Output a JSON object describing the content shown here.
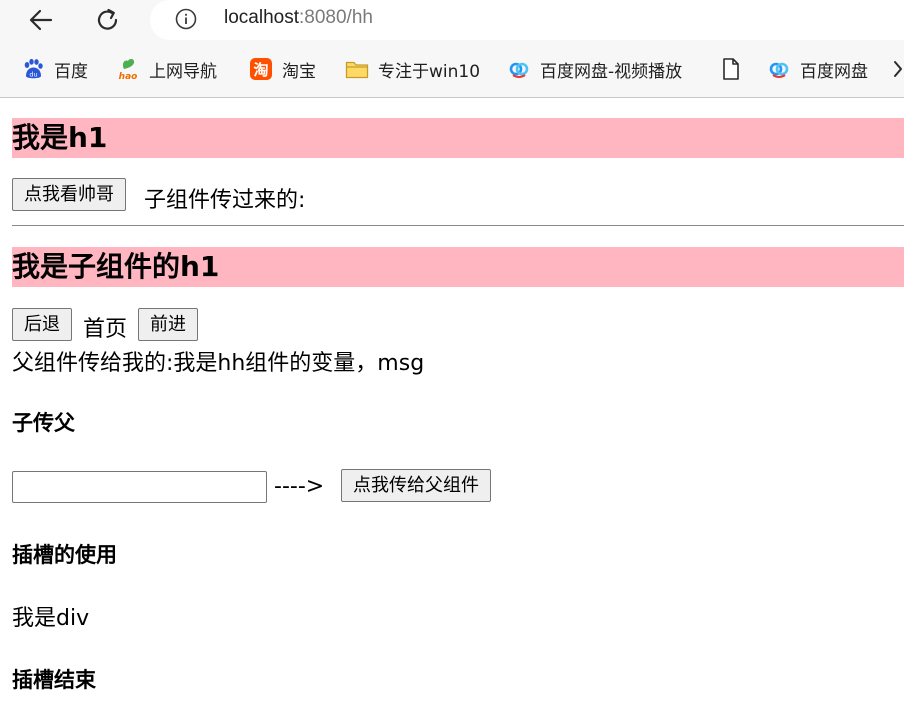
{
  "browser": {
    "url_host": "localhost",
    "url_rest": ":8080/hh",
    "bookmarks": [
      {
        "label": "百度",
        "icon": "baidu-paw-icon"
      },
      {
        "label": "上网导航",
        "icon": "hao-icon"
      },
      {
        "label": "淘宝",
        "icon": "taobao-icon"
      },
      {
        "label": "专注于win10",
        "icon": "folder-icon"
      },
      {
        "label": "百度网盘-视频播放",
        "icon": "baidu-netdisk-icon"
      },
      {
        "label": "",
        "icon": "document-icon"
      },
      {
        "label": "百度网盘",
        "icon": "baidu-netdisk-icon"
      }
    ]
  },
  "page": {
    "parent_title": "我是h1",
    "parent_button": "点我看帅哥",
    "parent_received_label": "子组件传过来的:",
    "child_title": "我是子组件的h1",
    "back_button": "后退",
    "home_label": "首页",
    "forward_button": "前进",
    "from_parent_text": "父组件传给我的:我是hh组件的变量，msg",
    "child_to_parent_heading": "子传父",
    "input_value": "",
    "arrow_text": "---->",
    "send_button": "点我传给父组件",
    "slot_heading": "插槽的使用",
    "slot_content": "我是div",
    "slot_end_heading": "插槽结束"
  },
  "colors": {
    "h1_background": "#ffb6c1",
    "chrome_background": "#f7f7f7"
  }
}
